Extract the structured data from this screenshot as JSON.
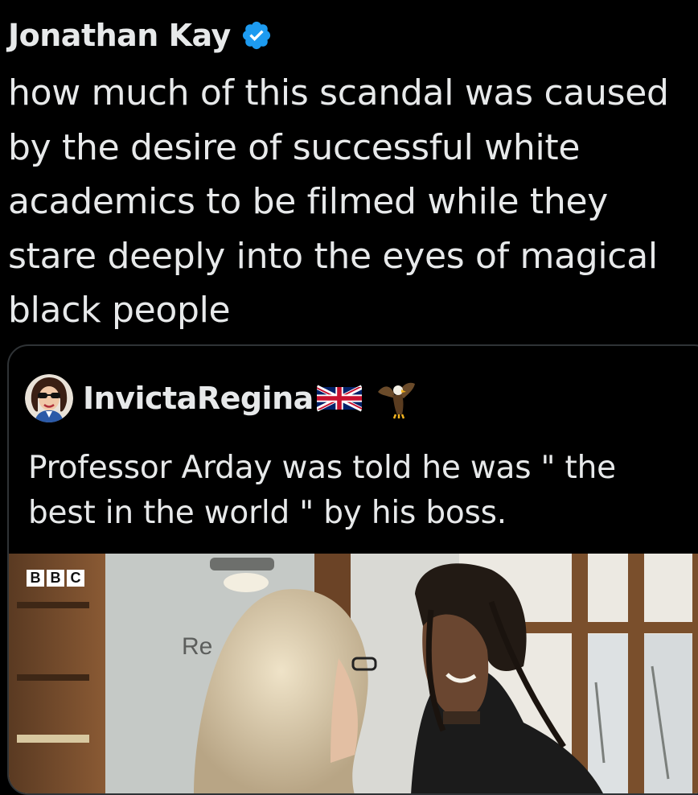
{
  "tweet": {
    "author_name": "Jonathan Kay",
    "verified_icon": "verified-badge-icon",
    "text": "how much of this scandal was caused by the desire of successful white academics to be filmed while they stare deeply into the eyes of magical black people"
  },
  "quoted_tweet": {
    "author_name": "InvictaRegina",
    "icons": [
      "union-jack-flag-icon",
      "eagle-icon"
    ],
    "text": "Professor Arday was told he was \" the best in the world \" by his boss.",
    "media": {
      "watermark": [
        "B",
        "B",
        "C"
      ],
      "wall_sign": "Re"
    }
  },
  "colors": {
    "background": "#000000",
    "text": "#e7e9ea",
    "verified_blue": "#1d9bf0",
    "card_border": "#2f3336"
  }
}
